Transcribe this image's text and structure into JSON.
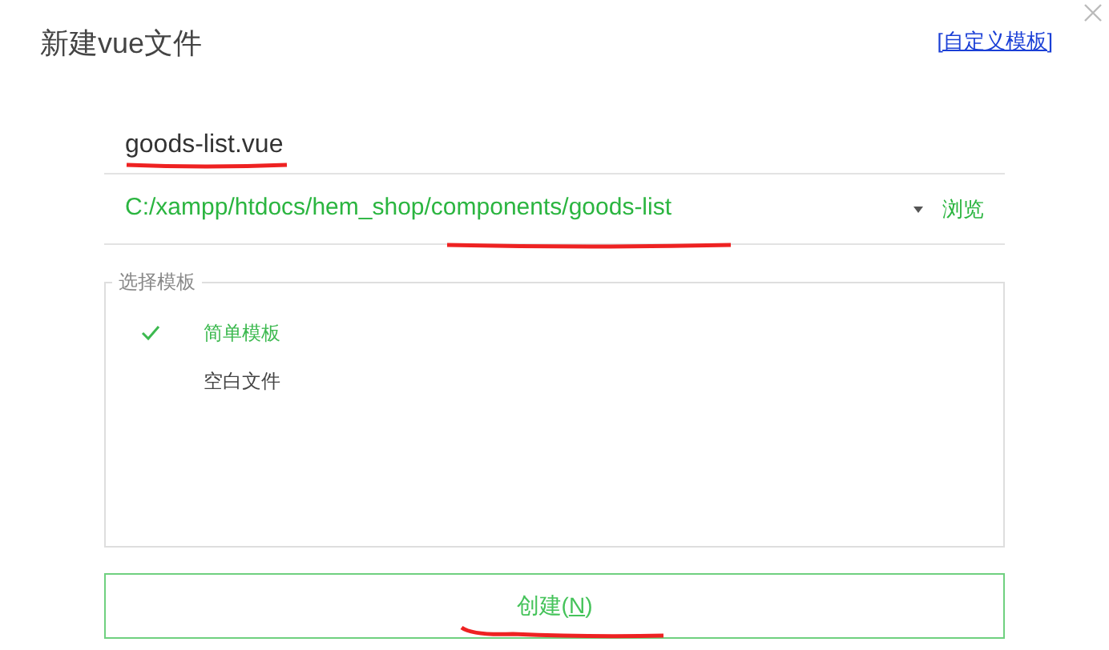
{
  "dialog": {
    "title": "新建vue文件",
    "custom_template_link": "[自定义模板]"
  },
  "file_name": {
    "value": "goods-list.vue"
  },
  "location": {
    "value": "C:/xampp/htdocs/hem_shop/components/goods-list",
    "browse": "浏览"
  },
  "templates": {
    "legend": "选择模板",
    "items": [
      {
        "label": "简单模板",
        "selected": true
      },
      {
        "label": "空白文件",
        "selected": false
      }
    ]
  },
  "create_button": {
    "label_before": "创建(",
    "mnemonic": "N",
    "label_after": ")"
  }
}
